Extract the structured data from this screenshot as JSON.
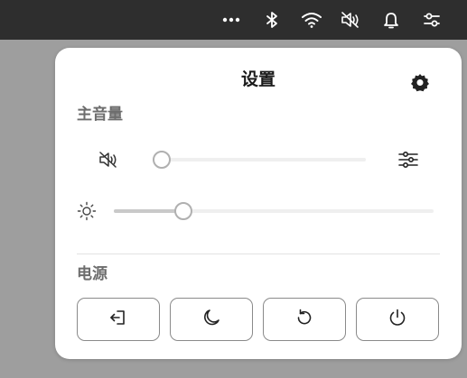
{
  "top_bar": {
    "icons": [
      "more-icon",
      "bluetooth-icon",
      "wifi-icon",
      "volume-muted-icon",
      "bell-icon",
      "control-center-icon"
    ]
  },
  "panel": {
    "title": "设置",
    "settings_icon": "gear-icon"
  },
  "volume": {
    "heading": "主音量",
    "icon": "volume-muted-icon",
    "level": 0,
    "options_icon": "sliders-icon"
  },
  "brightness": {
    "icon": "sun-icon",
    "level": 0.2
  },
  "power": {
    "heading": "电源",
    "buttons": [
      {
        "name": "logout-button",
        "icon": "logout-icon"
      },
      {
        "name": "sleep-button",
        "icon": "moon-icon"
      },
      {
        "name": "restart-button",
        "icon": "restart-icon"
      },
      {
        "name": "shutdown-button",
        "icon": "power-icon"
      }
    ]
  },
  "colors": {
    "top_bar": "#2e2e2e",
    "desktop": "#9e9e9e",
    "panel": "#ffffff",
    "heading": "#6d6d6d",
    "slider_fill": "#c9c9c9",
    "slider_track": "#efefef"
  }
}
